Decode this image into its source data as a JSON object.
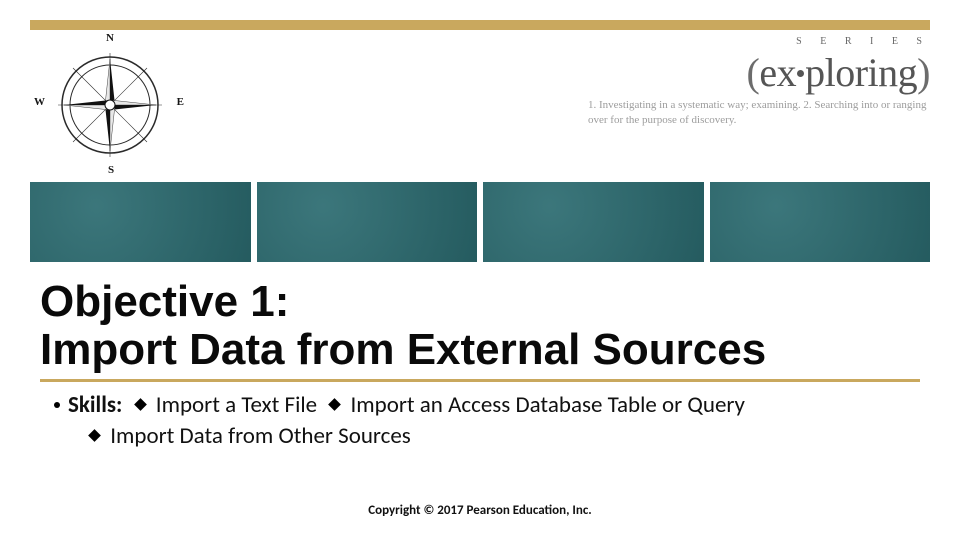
{
  "header": {
    "compass": {
      "n": "N",
      "s": "S",
      "e": "E",
      "w": "W"
    },
    "brand": {
      "series_label": "S  E  R  I  E  S",
      "logo_open": "(",
      "logo_ex": "ex",
      "logo_ploring": "ploring",
      "logo_close": ")",
      "definition": "1. Investigating in a systematic way; examining. 2. Searching into or ranging over for the purpose of discovery."
    }
  },
  "content": {
    "title_line1": "Objective 1:",
    "title_line2": "Import Data from External Sources",
    "skills_label": "Skills:",
    "skill1": " Import a Text File ",
    "skill2": " Import an Access Database Table or Query",
    "skill3": " Import Data from Other Sources"
  },
  "footer": {
    "copyright": "Copyright © 2017 Pearson Education, Inc."
  }
}
